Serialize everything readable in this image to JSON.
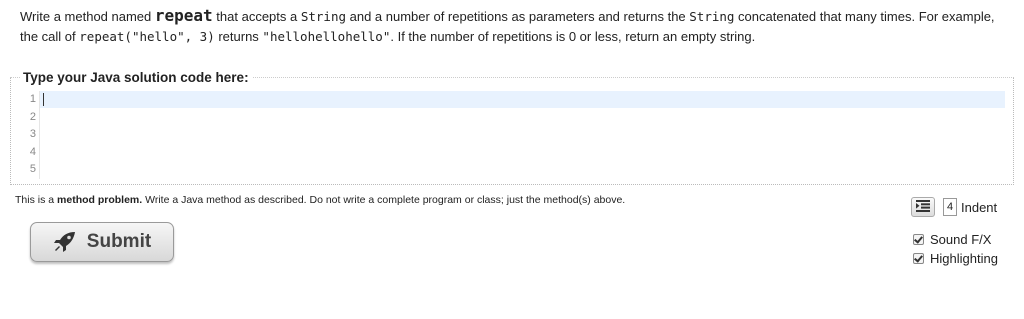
{
  "description": {
    "p1": "Write a method named ",
    "method_name": "repeat",
    "p2": " that accepts a ",
    "type1": "String",
    "p3": " and a number of repetitions as parameters and returns the ",
    "type2": "String",
    "p4": " concatenated that many times. For example, the call of ",
    "call": "repeat(\"hello\", 3)",
    "p5": " returns ",
    "result": "\"hellohellohello\"",
    "p6": ". If the number of repetitions is 0 or less, return an empty string."
  },
  "editor": {
    "legend": "Type your Java solution code here:",
    "line_numbers": [
      "1",
      "2",
      "3",
      "4",
      "5"
    ]
  },
  "hint": {
    "prefix": "This is a ",
    "bold": "method problem.",
    "rest": " Write a Java method as described. Do not write a complete program or class; just the method(s) above."
  },
  "submit": {
    "label": "Submit",
    "icon": "rocket-icon"
  },
  "settings": {
    "indent_value": "4",
    "indent_label": "Indent",
    "sound_label": "Sound F/X",
    "sound_checked": true,
    "highlighting_label": "Highlighting",
    "highlighting_checked": true
  }
}
